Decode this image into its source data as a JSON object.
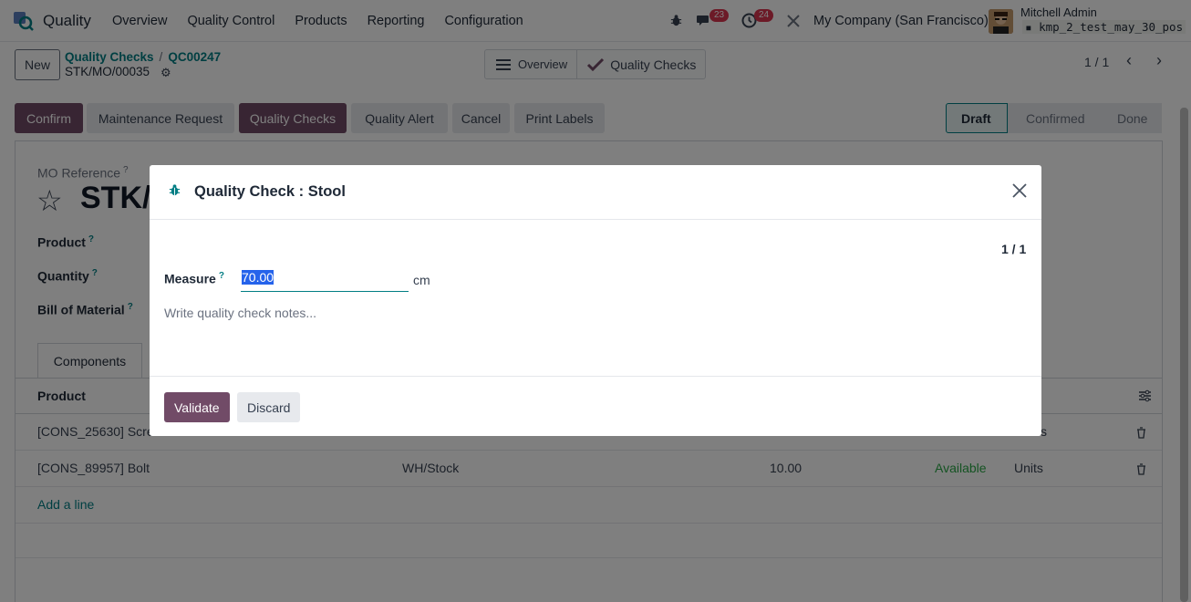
{
  "navbar": {
    "app_name": "Quality",
    "menu": [
      "Overview",
      "Quality Control",
      "Products",
      "Reporting",
      "Configuration"
    ],
    "messages_count": "23",
    "activities_count": "24",
    "company": "My Company (San Francisco)",
    "user_name": "Mitchell Admin",
    "db_name": "kmp_2_test_may_30_pos"
  },
  "control_panel": {
    "new_label": "New",
    "breadcrumb": [
      "Quality Checks",
      "QC00247"
    ],
    "record_name": "STK/MO/00035",
    "smart_buttons": [
      "Overview",
      "Quality Checks"
    ],
    "pager": "1 / 1"
  },
  "actions": [
    "Confirm",
    "Maintenance Request",
    "Quality Checks",
    "Quality Alert",
    "Cancel",
    "Print Labels"
  ],
  "statusbar": [
    "Draft",
    "Confirmed",
    "Done"
  ],
  "form": {
    "mo_reference_label": "MO Reference",
    "title_partial": "STK/",
    "labels": [
      "Product",
      "Quantity",
      "Bill of Material"
    ],
    "tab": "Components",
    "table_header_product": "Product",
    "rows": [
      {
        "product": "[CONS_25630] Scre",
        "location": "",
        "qty": "",
        "status": "",
        "uom": "s"
      },
      {
        "product": "[CONS_89957] Bolt",
        "location": "WH/Stock",
        "qty": "10.00",
        "status": "Available",
        "uom": "Units"
      }
    ],
    "add_line": "Add a line"
  },
  "modal": {
    "title": "Quality Check : Stool",
    "counter": "1 / 1",
    "measure_label": "Measure",
    "measure_value": "70.00",
    "unit": "cm",
    "notes_placeholder": "Write quality check notes...",
    "validate_label": "Validate",
    "discard_label": "Discard"
  },
  "colors": {
    "primary": "#714b67",
    "link": "#017e84",
    "badge": "#d9344f",
    "available": "#28a745"
  }
}
